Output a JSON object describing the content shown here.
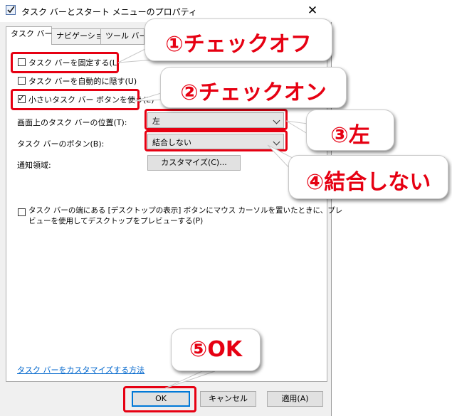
{
  "window": {
    "title": "タスク バーとスタート メニューのプロパティ",
    "close_glyph": "✕"
  },
  "tabs": [
    {
      "label": "タスク バー"
    },
    {
      "label": "ナビゲーション"
    },
    {
      "label": "ツール バー"
    }
  ],
  "options": {
    "lock_taskbar": {
      "label": "タスク バーを固定する(L)",
      "checked": false
    },
    "auto_hide": {
      "label": "タスク バーを自動的に隠す(U)",
      "checked": false
    },
    "small_buttons": {
      "label": "小さいタスク バー ボタンを使う(E)",
      "checked": true
    },
    "check_glyph": "✓"
  },
  "position": {
    "label": "画面上のタスク バーの位置(T):",
    "value": "左"
  },
  "buttons_combine": {
    "label": "タスク バーのボタン(B):",
    "value": "結合しない"
  },
  "notification": {
    "label": "通知領域:",
    "customize_label": "カスタマイズ(C)..."
  },
  "peek": {
    "line1": "タスク バーの端にある [デスクトップの表示] ボタンにマウス カーソルを置いたときに、プレ",
    "line2": "ビューを使用してデスクトップをプレビューする(P)",
    "checked": false
  },
  "help_link": "タスク バーをカスタマイズする方法",
  "footer": {
    "ok": "OK",
    "cancel": "キャンセル",
    "apply": "適用(A)"
  },
  "annotations": {
    "c1": "①チェックオフ",
    "c2": "②チェックオン",
    "c3": "③左",
    "c4": "④結合しない",
    "c5": "⑤OK",
    "highlight_color": "#e60012"
  }
}
